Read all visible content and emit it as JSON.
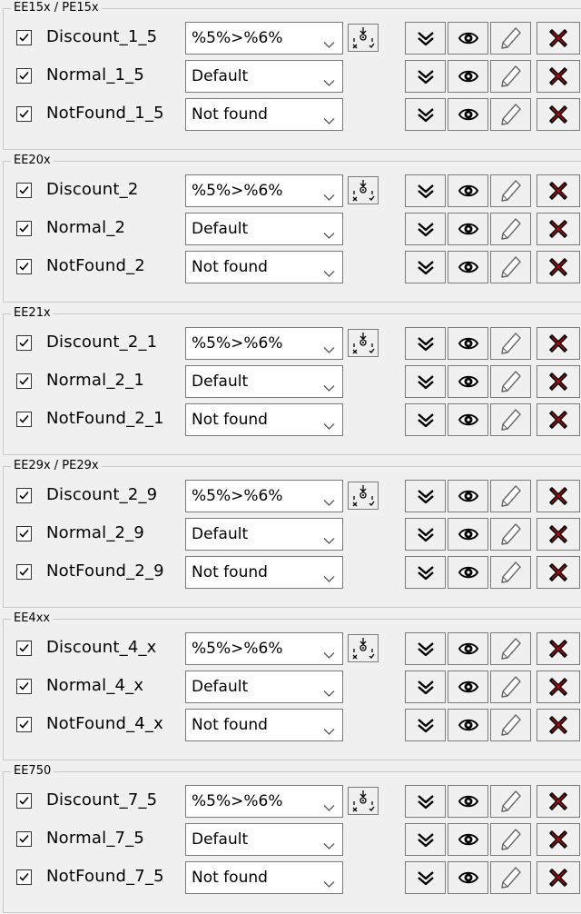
{
  "groups": [
    {
      "title": "EE15x / PE15x",
      "rows": [
        {
          "name": "Discount_1_5",
          "value": "%5%>%6%"
        },
        {
          "name": "Normal_1_5",
          "value": "Default"
        },
        {
          "name": "NotFound_1_5",
          "value": "Not found"
        }
      ]
    },
    {
      "title": "EE20x",
      "rows": [
        {
          "name": "Discount_2",
          "value": "%5%>%6%"
        },
        {
          "name": "Normal_2",
          "value": "Default"
        },
        {
          "name": "NotFound_2",
          "value": "Not found"
        }
      ]
    },
    {
      "title": "EE21x",
      "rows": [
        {
          "name": "Discount_2_1",
          "value": "%5%>%6%"
        },
        {
          "name": "Normal_2_1",
          "value": "Default"
        },
        {
          "name": "NotFound_2_1",
          "value": "Not found"
        }
      ]
    },
    {
      "title": "EE29x / PE29x",
      "rows": [
        {
          "name": "Discount_2_9",
          "value": "%5%>%6%"
        },
        {
          "name": "Normal_2_9",
          "value": "Default"
        },
        {
          "name": "NotFound_2_9",
          "value": "Not found"
        }
      ]
    },
    {
      "title": "EE4xx",
      "rows": [
        {
          "name": "Discount_4_x",
          "value": "%5%>%6%"
        },
        {
          "name": "Normal_4_x",
          "value": "Default"
        },
        {
          "name": "NotFound_4_x",
          "value": "Not found"
        }
      ]
    },
    {
      "title": "EE750",
      "rows": [
        {
          "name": "Discount_7_5",
          "value": "%5%>%6%"
        },
        {
          "name": "Normal_7_5",
          "value": "Default"
        },
        {
          "name": "NotFound_7_5",
          "value": "Not found"
        }
      ]
    }
  ],
  "checked": true,
  "icons": {
    "checkbox": "checkmark-icon",
    "combo": "chevron-down-icon",
    "tool": "format-variables-icon",
    "expand": "double-chevron-down-icon",
    "view": "eye-icon",
    "edit": "pencil-icon",
    "delete": "red-x-icon"
  },
  "colors": {
    "delete": "#e0001a",
    "background": "#f0f0f0",
    "border": "#7a7a7a"
  }
}
